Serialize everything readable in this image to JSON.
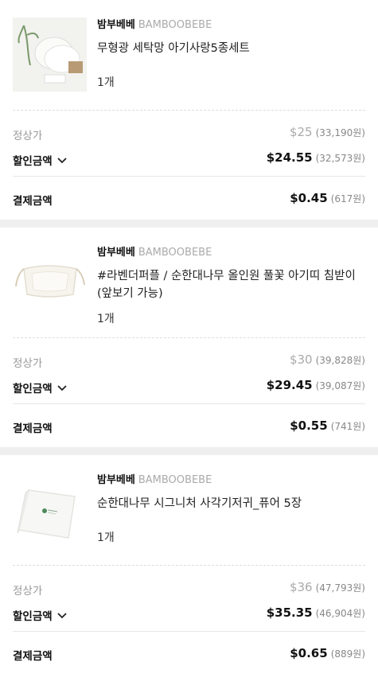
{
  "orders": [
    {
      "brand_ko": "밤부베베",
      "brand_en": "BAMBOOBEBE",
      "name": "무형광 세탁망 아기사랑5종세트",
      "qty": "1개",
      "regular_label": "정상가",
      "regular_price": "$25",
      "regular_krw": "(33,190원)",
      "discount_label": "할인금액",
      "discount_price": "$24.55",
      "discount_krw": "(32,573원)",
      "pay_label": "결제금액",
      "pay_price": "$0.45",
      "pay_krw": "(617원)",
      "thumb_icon": "laundry-net-set-image"
    },
    {
      "brand_ko": "밤부베베",
      "brand_en": "BAMBOOBEBE",
      "name": "#라벤더퍼플 / 순한대나무 올인원 풀꽃 아기띠 침받이(앞보기 가능)",
      "qty": "1개",
      "regular_label": "정상가",
      "regular_price": "$30",
      "regular_krw": "(39,828원)",
      "discount_label": "할인금액",
      "discount_price": "$29.45",
      "discount_krw": "(39,087원)",
      "pay_label": "결제금액",
      "pay_price": "$0.55",
      "pay_krw": "(741원)",
      "thumb_icon": "drool-pad-image"
    },
    {
      "brand_ko": "밤부베베",
      "brand_en": "BAMBOOBEBE",
      "name": "순한대나무 시그니처 사각기저귀_퓨어 5장",
      "qty": "1개",
      "regular_label": "정상가",
      "regular_price": "$36",
      "regular_krw": "(47,793원)",
      "discount_label": "할인금액",
      "discount_price": "$35.35",
      "discount_krw": "(46,904원)",
      "pay_label": "결제금액",
      "pay_price": "$0.65",
      "pay_krw": "(889원)",
      "thumb_icon": "square-diaper-image"
    }
  ]
}
